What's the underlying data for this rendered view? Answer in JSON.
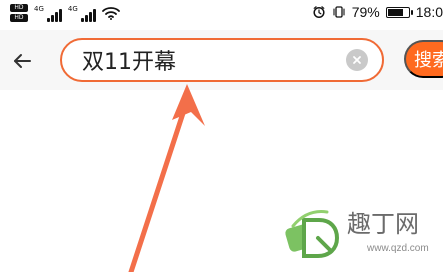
{
  "status_bar": {
    "left_badges": [
      "HD",
      "HD"
    ],
    "signal_labels": [
      "4G",
      "4G"
    ],
    "battery_text": "79%",
    "time_text": "18:0"
  },
  "search": {
    "query": "双11开幕",
    "button_label": "搜索"
  },
  "icons": {
    "back": "back-arrow-icon",
    "clear": "clear-icon",
    "alarm": "alarm-icon",
    "vibrate": "vibrate-icon",
    "wifi": "wifi-icon"
  },
  "colors": {
    "accent_orange": "#ff6a1f",
    "search_border": "#f06a35",
    "annotation_orange": "#f36f4a",
    "watermark_green": "#67b74c"
  },
  "watermark": {
    "title": "趣丁网",
    "url": "www.qzd.com"
  }
}
